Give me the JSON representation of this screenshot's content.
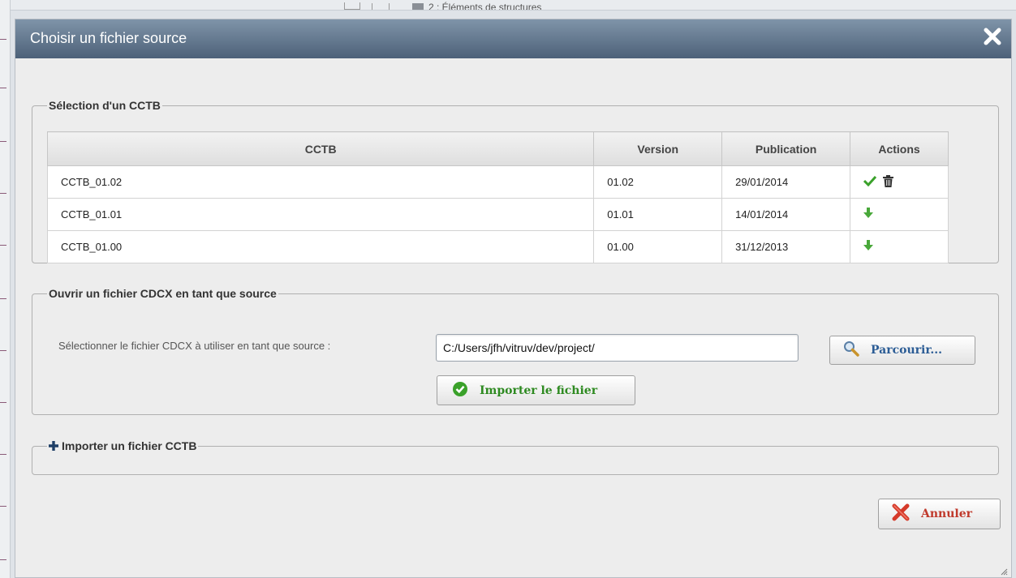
{
  "background": {
    "breadcrumb_text": "2 : Éléments de structures"
  },
  "dialog": {
    "title": "Choisir un fichier source",
    "close_icon": "close-icon"
  },
  "cctb_section": {
    "legend": "Sélection d'un CCTB",
    "columns": [
      "CCTB",
      "Version",
      "Publication",
      "Actions"
    ],
    "rows": [
      {
        "name": "CCTB_01.02",
        "version": "01.02",
        "publication": "29/01/2014",
        "actions": [
          "check-icon",
          "trash-icon"
        ]
      },
      {
        "name": "CCTB_01.01",
        "version": "01.01",
        "publication": "14/01/2014",
        "actions": [
          "download-arrow-icon"
        ]
      },
      {
        "name": "CCTB_01.00",
        "version": "01.00",
        "publication": "31/12/2013",
        "actions": [
          "download-arrow-icon"
        ]
      }
    ]
  },
  "cdcx_section": {
    "legend": "Ouvrir un fichier CDCX en tant que source",
    "label": "Sélectionner le fichier CDCX à utiliser en tant que source :",
    "path_value": "C:/Users/jfh/vitruv/dev/project/",
    "browse_label": "Parcourir...",
    "import_label": "Importer le fichier"
  },
  "import_cctb_section": {
    "legend": "Importer un fichier CCTB"
  },
  "footer": {
    "cancel_label": "Annuler"
  },
  "colors": {
    "titlebar_top": "#7f94a9",
    "titlebar_bottom": "#4d6179",
    "import_green": "#2e8a21",
    "browse_blue": "#2b5c95",
    "cancel_red": "#c0392b"
  }
}
